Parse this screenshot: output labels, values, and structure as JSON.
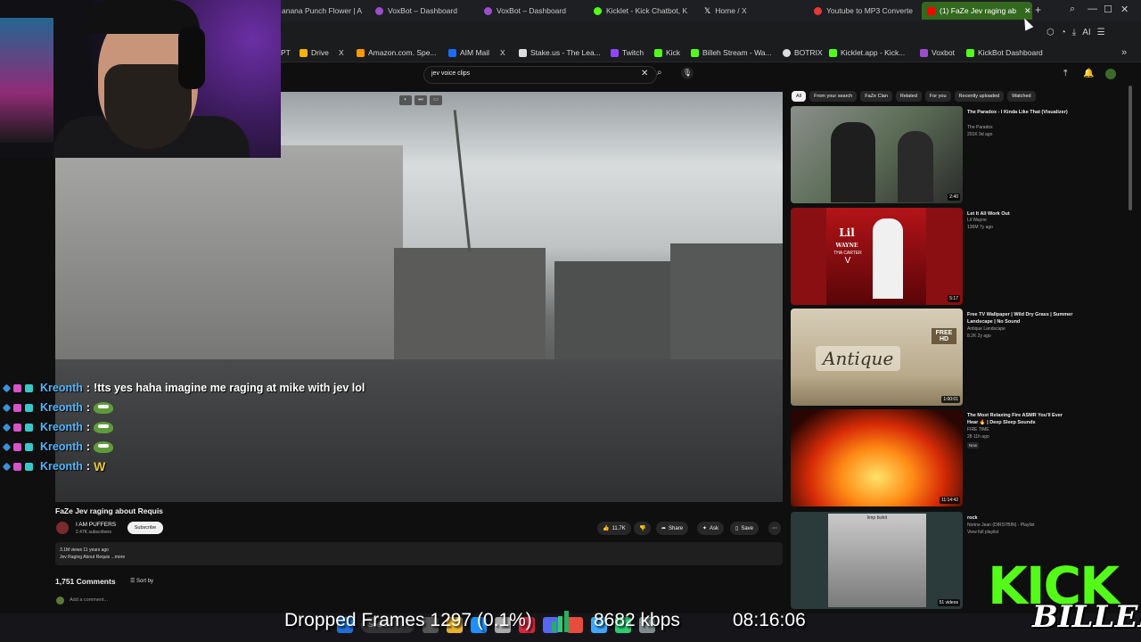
{
  "tabs": [
    {
      "label": "anana Punch Flower | A",
      "color": "#666666"
    },
    {
      "label": "VoxBot – Dashboard",
      "color": "#9b4dca"
    },
    {
      "label": "VoxBot – Dashboard",
      "color": "#9b4dca"
    },
    {
      "label": "Kicklet - Kick Chatbot, K",
      "color": "#53fc18"
    },
    {
      "label": "Home / X",
      "color": "#ffffff"
    },
    {
      "label": "Youtube to MP3 Converte",
      "color": "#e53935"
    },
    {
      "label": "(1) FaZe Jev raging ab",
      "color": "#ff0000",
      "active": true
    }
  ],
  "bookmarks": [
    {
      "label": "PT",
      "color": "#10a37f"
    },
    {
      "label": "Drive",
      "color": "#f4b400"
    },
    {
      "label": "X",
      "color": "#ffffff"
    },
    {
      "label": "Amazon.com. Spe...",
      "color": "#ff9900"
    },
    {
      "label": "AIM Mail",
      "color": "#1a6ef5"
    },
    {
      "label": "X",
      "color": "#ffffff"
    },
    {
      "label": "Stake.us - The Lea...",
      "color": "#ffffff"
    },
    {
      "label": "Twitch",
      "color": "#9146ff"
    },
    {
      "label": "Kick",
      "color": "#53fc18"
    },
    {
      "label": "Billeh Stream - Wa...",
      "color": "#53fc18"
    },
    {
      "label": "BOTRIX",
      "color": "#ffffff"
    },
    {
      "label": "Kicklet.app - Kick...",
      "color": "#53fc18"
    },
    {
      "label": "Voxbot",
      "color": "#9b4dca"
    },
    {
      "label": "KickBot Dashboard",
      "color": "#53fc18"
    }
  ],
  "toolbar": {
    "ai_label": "AI"
  },
  "search": {
    "query": "jev voice clips"
  },
  "chat": [
    {
      "user": "Kreonth",
      "message": "!tts yes haha imagine me raging at mike with jev lol",
      "emote": ""
    },
    {
      "user": "Kreonth",
      "message": "",
      "emote": "pepe"
    },
    {
      "user": "Kreonth",
      "message": "",
      "emote": "pepe"
    },
    {
      "user": "Kreonth",
      "message": "",
      "emote": "pepe"
    },
    {
      "user": "Kreonth",
      "message": "W",
      "emote": ""
    }
  ],
  "video": {
    "title": "FaZe Jev raging about Requis",
    "channel": "I AM PUFFERS",
    "subs": "2.47K subscribers",
    "subscribe_label": "Subscribe",
    "likes": "11.7K",
    "share_label": "Share",
    "ask_label": "Ask",
    "save_label": "Save",
    "views_line": "3.1M views  11 years ago",
    "desc_line": "Jev Raging About Requis ...more",
    "comments": "1,751 Comments",
    "sort_label": "Sort by",
    "add_comment": "Add a comment..."
  },
  "chips": [
    "All",
    "From your search",
    "FaZe Clan",
    "Related",
    "For you",
    "Recently uploaded",
    "Watched"
  ],
  "recommendations": [
    {
      "title": "The Paradox - I Kinda Like That (Visualizer)",
      "channel": "The Paradox",
      "meta": "201K  9d ago",
      "duration": "2:40",
      "badge": ""
    },
    {
      "title": "Let It All Work Out",
      "channel": "Lil Wayne",
      "meta": "136M  7y ago",
      "duration": "5:17",
      "badge": ""
    },
    {
      "title": "Free TV Wallpaper | Wild Dry Grass | Summer Landscape | No Sound",
      "channel": "Antique Landscape",
      "meta": "8.2K  2y ago",
      "duration": "1:00:01",
      "badge": ""
    },
    {
      "title": "The Most Relaxing Fire ASMR You'll Ever Hear 🔥 | Deep Sleep Sounds",
      "channel": "FIRE TIME",
      "meta": "28  11h ago",
      "duration": "11:14:42",
      "badge": "New"
    },
    {
      "title": "rock",
      "channel": "Norine Jean (DIRSYBIN) - Playlist",
      "meta": "View full playlist",
      "duration": "51 videos",
      "badge": ""
    }
  ],
  "thumb_text": {
    "carter_line1": "Lil",
    "carter_line2": "WAYNE",
    "carter_line3": "THA CARTER",
    "carter_line4": "V",
    "antique": "Antique",
    "free_hd": "FREE HD",
    "limp": "limp bizkit"
  },
  "overlay": {
    "dropped_frames": "Dropped Frames 1297 (0.1%)",
    "kbps": "8682 kbps",
    "clock": "08:16:06",
    "kick": "KICK",
    "billeh": "BILLEH",
    "taskbar_search": "Search"
  },
  "colors": {
    "accent_green": "#53fc18",
    "youtube_red": "#ff0000",
    "chat_user": "#4fb6ff"
  }
}
